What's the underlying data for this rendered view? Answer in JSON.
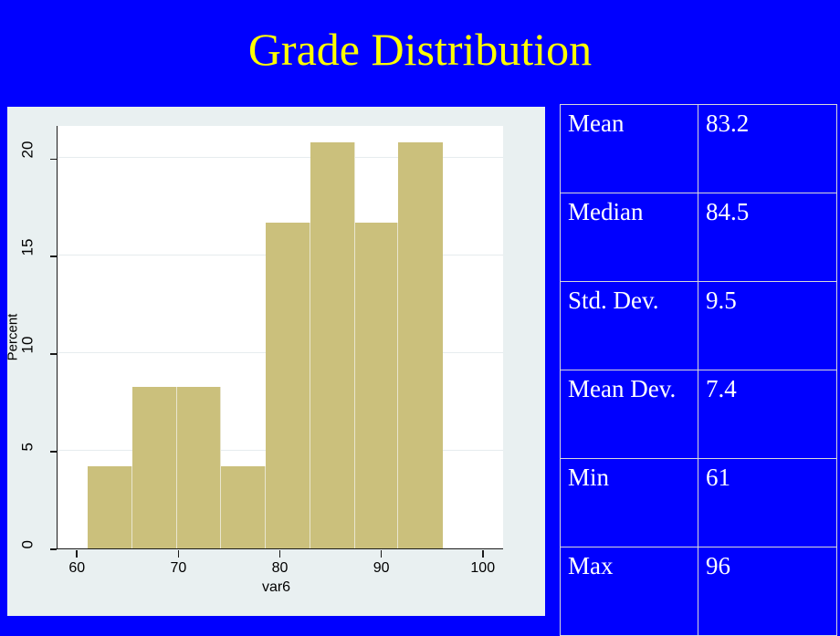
{
  "slide": {
    "title": "Grade Distribution",
    "background_color": "#0000FF",
    "title_color": "#FFFF00"
  },
  "chart_data": {
    "type": "bar",
    "title": "",
    "xlabel": "var6",
    "ylabel": "Percent",
    "xlim": [
      58,
      102
    ],
    "ylim": [
      0,
      21.7
    ],
    "grid": true,
    "legend": null,
    "bar_color": "#CBC07C",
    "plot_background": "#FFFFFF",
    "panel_background": "#E9F0F1",
    "x_ticks": [
      "60",
      "70",
      "80",
      "90",
      "100"
    ],
    "x_tick_values": [
      60,
      70,
      80,
      90,
      100
    ],
    "y_ticks": [
      "0",
      "5",
      "10",
      "15",
      "20"
    ],
    "y_tick_values": [
      0,
      5,
      10,
      15,
      20
    ],
    "bin_edges": [
      61,
      65.4,
      69.8,
      74.1,
      78.5,
      82.9,
      87.3,
      91.6,
      96
    ],
    "categories": [
      "61-65.4",
      "65.4-69.8",
      "69.8-74.1",
      "74.1-78.5",
      "78.5-82.9",
      "82.9-87.3",
      "87.3-91.6",
      "91.6-96"
    ],
    "values": [
      4.2,
      8.3,
      8.3,
      4.2,
      16.7,
      20.8,
      16.7,
      20.8
    ]
  },
  "stats_table": {
    "rows": [
      {
        "label": "Mean",
        "value": "83.2"
      },
      {
        "label": "Median",
        "value": "84.5"
      },
      {
        "label": "Std. Dev.",
        "value": "9.5"
      },
      {
        "label": "Mean Dev.",
        "value": "7.4"
      },
      {
        "label": "Min",
        "value": "61"
      },
      {
        "label": "Max",
        "value": "96"
      }
    ],
    "border_color": "#D9D9D9",
    "text_color": "#FFFFFF"
  }
}
